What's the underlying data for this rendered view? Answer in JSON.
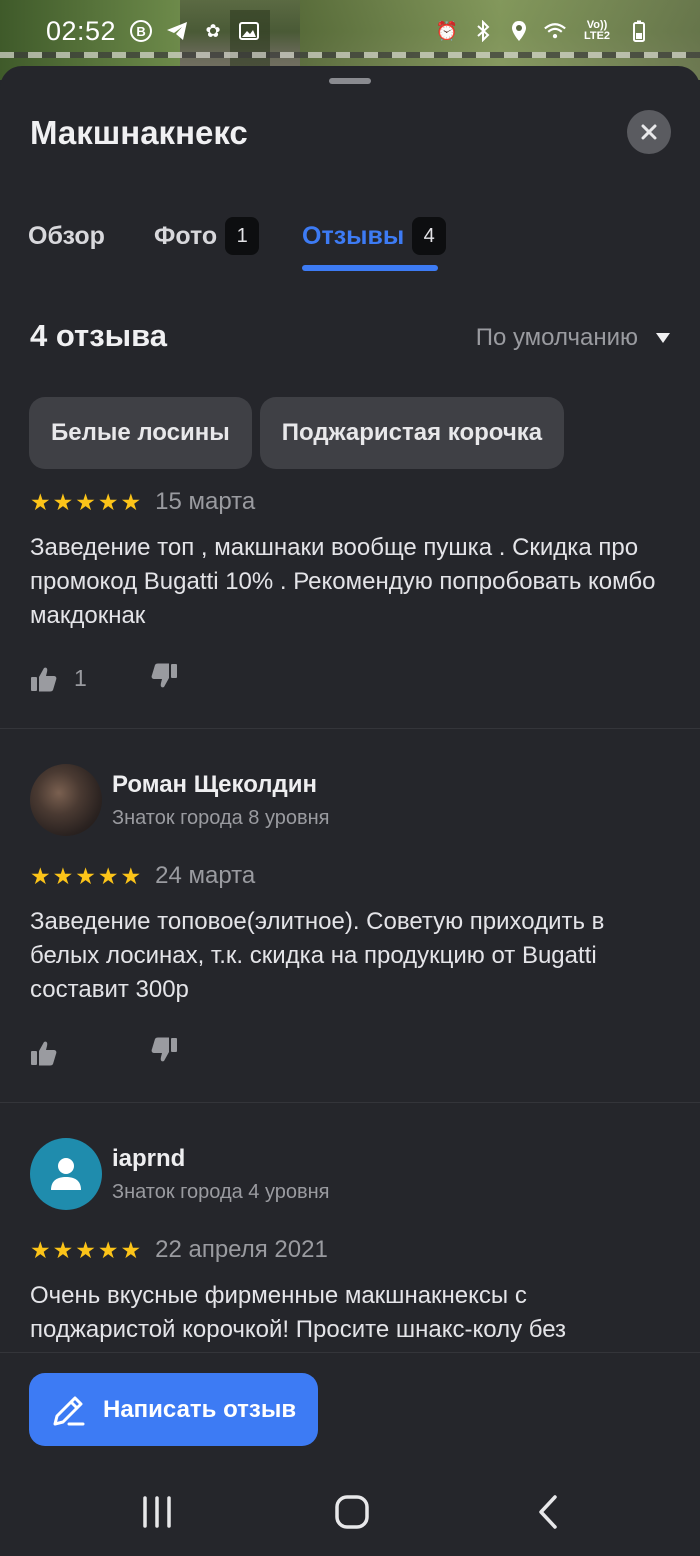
{
  "status_bar": {
    "time": "02:52",
    "left_icons": [
      "b-circle-icon",
      "telegram-icon",
      "fan-icon",
      "image-icon"
    ],
    "right_icons": [
      "alarm-icon",
      "bluetooth-icon",
      "location-icon",
      "wifi-icon",
      "lte-signal-icon",
      "battery-icon"
    ],
    "lte_label": "Vo)) LTE2"
  },
  "header": {
    "title": "Макшнакнекс"
  },
  "tabs": [
    {
      "label": "Обзор",
      "count": null,
      "active": false
    },
    {
      "label": "Фото",
      "count": "1",
      "active": false
    },
    {
      "label": "Отзывы",
      "count": "4",
      "active": true
    }
  ],
  "reviews_header": {
    "count_label": "4 отзыва",
    "sort_label": "По умолчанию"
  },
  "chips": [
    {
      "label": "Белые лосины"
    },
    {
      "label": "Поджаристая корочка"
    }
  ],
  "reviews": [
    {
      "author": null,
      "rating": 5,
      "date": "15 марта",
      "text": "Заведение топ , макшнаки вообще пушка . Скидка про промокод Bugatti 10% . Рекомендую попробовать комбо макдокнак",
      "likes": "1"
    },
    {
      "author": {
        "name": "Роман Щеколдин",
        "level": "Знаток города 8 уровня",
        "avatar": "photo"
      },
      "rating": 5,
      "date": "24 марта",
      "text": "Заведение топовое(элитное). Советую приходить в белых лосинах, т.к. скидка на продукцию от Bugatti составит 300р",
      "likes": ""
    },
    {
      "author": {
        "name": "iaprnd",
        "level": "Знаток города 4 уровня",
        "avatar": "default"
      },
      "rating": 5,
      "date": "22 апреля 2021",
      "text": "Очень вкусные фирменные макшнакнексы с поджаристой корочкой! Просите шнакс-колу без",
      "likes": ""
    }
  ],
  "bottom": {
    "write_review_label": "Написать отзыв"
  },
  "colors": {
    "accent": "#3d7bf4",
    "background": "#25262b",
    "star": "#fcc419",
    "chip": "#3f4045",
    "avatar_default": "#1f8cad"
  }
}
